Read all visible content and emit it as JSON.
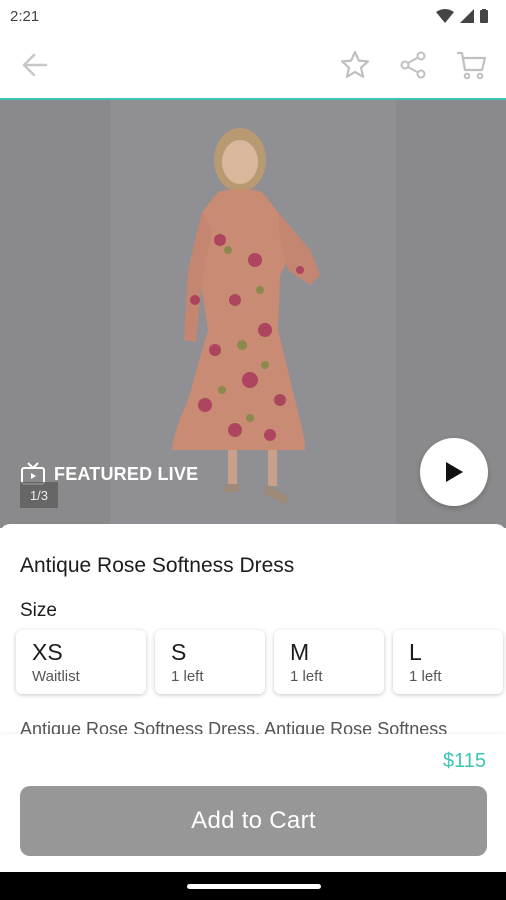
{
  "status": {
    "time": "2:21"
  },
  "app_bar": {
    "back_icon": "arrow-left-icon",
    "favorite_icon": "star-icon",
    "share_icon": "share-icon",
    "cart_icon": "cart-icon"
  },
  "hero": {
    "featured_label": "FEATURED LIVE",
    "image_counter": "1/3",
    "play_icon": "play-icon"
  },
  "product": {
    "name": "Antique Rose Softness Dress",
    "size_heading": "Size",
    "sizes": [
      {
        "size": "XS",
        "status": "Waitlist"
      },
      {
        "size": "S",
        "status": "1 left"
      },
      {
        "size": "M",
        "status": "1 left"
      },
      {
        "size": "L",
        "status": "1 left"
      }
    ],
    "description": "Antique Rose Softness Dress. Antique Rose Softness"
  },
  "footer": {
    "price": "$115",
    "add_to_cart_label": "Add to Cart"
  },
  "colors": {
    "accent": "#3cc7b3",
    "button_disabled": "#979797"
  }
}
